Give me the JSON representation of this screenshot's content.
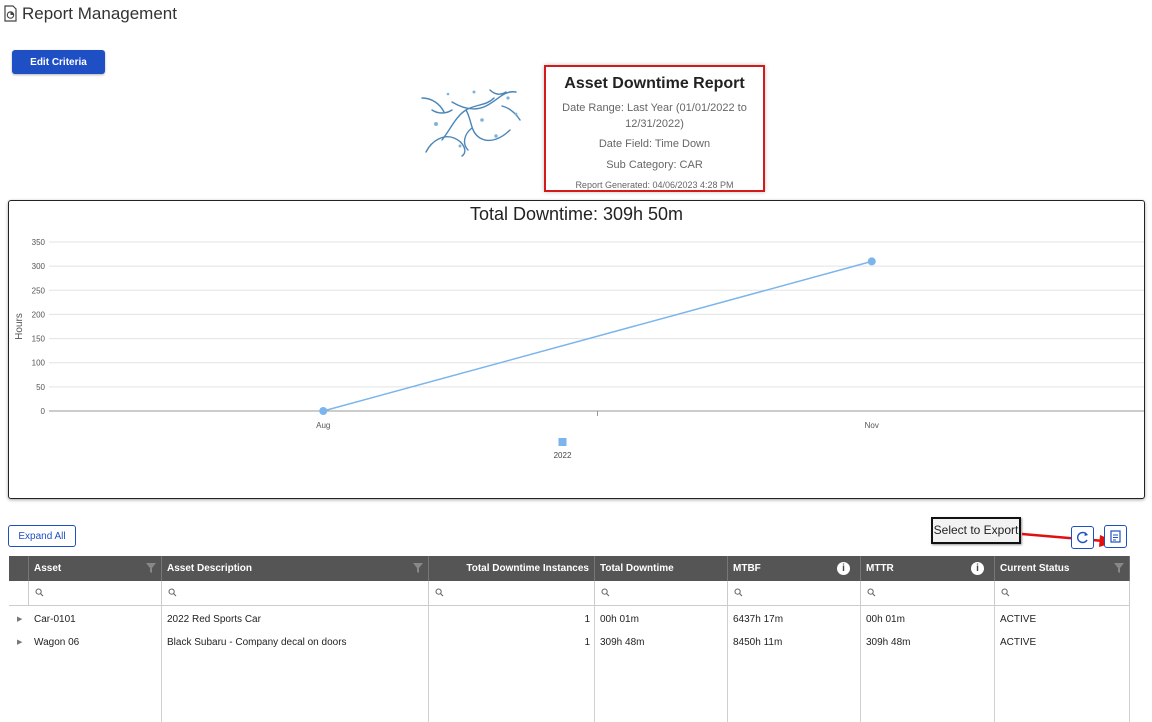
{
  "header": {
    "title": "Report Management"
  },
  "toolbar": {
    "edit_criteria": "Edit Criteria",
    "expand_all": "Expand All"
  },
  "report": {
    "title": "Asset Downtime Report",
    "date_range": "Date Range: Last Year (01/01/2022 to 12/31/2022)",
    "date_field": "Date Field: Time Down",
    "sub_category": "Sub Category: CAR",
    "generated": "Report Generated: 04/06/2023 4:28 PM"
  },
  "chart_data": {
    "type": "line",
    "title": "Total Downtime: 309h 50m",
    "ylabel": "Hours",
    "xlabel": "",
    "ylim": [
      0,
      350
    ],
    "y_ticks": [
      0,
      50,
      100,
      150,
      200,
      250,
      300,
      350
    ],
    "categories": [
      "Aug",
      "Nov"
    ],
    "series": [
      {
        "name": "2022",
        "values": [
          0,
          309.8
        ],
        "color": "#7cb5ec"
      }
    ],
    "grid": true,
    "legend_position": "bottom"
  },
  "annotation": {
    "callout": "Select to Export"
  },
  "table": {
    "columns": [
      "Asset",
      "Asset Description",
      "Total Downtime Instances",
      "Total Downtime",
      "MTBF",
      "MTTR",
      "Current Status"
    ],
    "rows": [
      [
        "Car-0101",
        "2022 Red Sports Car",
        "1",
        "00h 01m",
        "6437h 17m",
        "00h 01m",
        "ACTIVE"
      ],
      [
        "Wagon 06",
        "Black Subaru - Company decal on doors",
        "1",
        "309h 48m",
        "8450h 11m",
        "309h 48m",
        "ACTIVE"
      ]
    ]
  },
  "colors": {
    "accent": "#1f4fc4",
    "header_bg": "#555555",
    "highlight": "#d31a1a",
    "series": "#7cb5ec"
  }
}
